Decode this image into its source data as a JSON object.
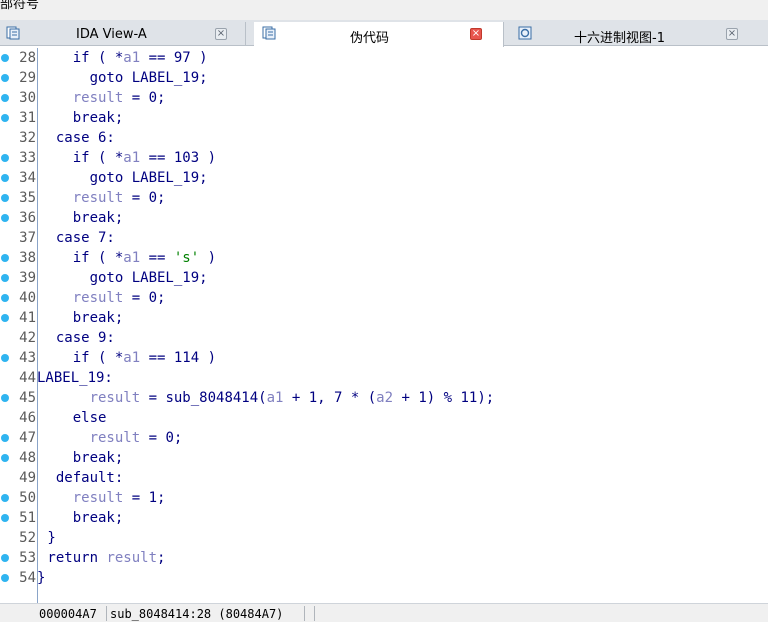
{
  "topbar": {
    "title": "部符号"
  },
  "tabs": [
    {
      "label": "IDA View-A",
      "icon": "ida-view-icon",
      "active": false
    },
    {
      "label": "伪代码",
      "icon": "pseudocode-icon",
      "active": true
    },
    {
      "label": "十六进制视图-1",
      "icon": "hex-view-icon",
      "active": false
    }
  ],
  "tab_close_glyph": "×",
  "colors": {
    "keyword": "#000080",
    "variable": "#8080c0",
    "breakpoint_dot": "#2fb4f0",
    "active_close": "#e8554e"
  },
  "code_lines": [
    {
      "num": "28",
      "dot": true,
      "segs": [
        [
          "    if ( *",
          ""
        ],
        [
          "a1",
          "v"
        ],
        [
          " == 97 )",
          ""
        ]
      ]
    },
    {
      "num": "29",
      "dot": true,
      "segs": [
        [
          "      goto LABEL_19;",
          ""
        ]
      ]
    },
    {
      "num": "30",
      "dot": true,
      "segs": [
        [
          "    ",
          ""
        ],
        [
          "result",
          "v"
        ],
        [
          " = 0;",
          ""
        ]
      ]
    },
    {
      "num": "31",
      "dot": true,
      "segs": [
        [
          "    break;",
          ""
        ]
      ]
    },
    {
      "num": "32",
      "dot": false,
      "segs": [
        [
          "  case 6:",
          ""
        ]
      ]
    },
    {
      "num": "33",
      "dot": true,
      "segs": [
        [
          "    if ( *",
          ""
        ],
        [
          "a1",
          "v"
        ],
        [
          " == 103 )",
          ""
        ]
      ]
    },
    {
      "num": "34",
      "dot": true,
      "segs": [
        [
          "      goto LABEL_19;",
          ""
        ]
      ]
    },
    {
      "num": "35",
      "dot": true,
      "segs": [
        [
          "    ",
          ""
        ],
        [
          "result",
          "v"
        ],
        [
          " = 0;",
          ""
        ]
      ]
    },
    {
      "num": "36",
      "dot": true,
      "segs": [
        [
          "    break;",
          ""
        ]
      ]
    },
    {
      "num": "37",
      "dot": false,
      "segs": [
        [
          "  case 7:",
          ""
        ]
      ]
    },
    {
      "num": "38",
      "dot": true,
      "segs": [
        [
          "    if ( *",
          ""
        ],
        [
          "a1",
          "v"
        ],
        [
          " == ",
          ""
        ],
        [
          "'s'",
          "s"
        ],
        [
          " )",
          ""
        ]
      ]
    },
    {
      "num": "39",
      "dot": true,
      "segs": [
        [
          "      goto LABEL_19;",
          ""
        ]
      ]
    },
    {
      "num": "40",
      "dot": true,
      "segs": [
        [
          "    ",
          ""
        ],
        [
          "result",
          "v"
        ],
        [
          " = 0;",
          ""
        ]
      ]
    },
    {
      "num": "41",
      "dot": true,
      "segs": [
        [
          "    break;",
          ""
        ]
      ]
    },
    {
      "num": "42",
      "dot": false,
      "segs": [
        [
          "  case 9:",
          ""
        ]
      ]
    },
    {
      "num": "43",
      "dot": true,
      "segs": [
        [
          "    if ( *",
          ""
        ],
        [
          "a1",
          "v"
        ],
        [
          " == 114 )",
          ""
        ]
      ]
    },
    {
      "num": "44",
      "dot": false,
      "segs": [
        [
          "LABEL_19:",
          ""
        ]
      ],
      "nogap": true
    },
    {
      "num": "45",
      "dot": true,
      "segs": [
        [
          "      ",
          ""
        ],
        [
          "result",
          "v"
        ],
        [
          " = sub_8048414(",
          ""
        ],
        [
          "a1",
          "v"
        ],
        [
          " + 1, 7 * (",
          ""
        ],
        [
          "a2",
          "v"
        ],
        [
          " + 1) % 11);",
          ""
        ]
      ]
    },
    {
      "num": "46",
      "dot": false,
      "segs": [
        [
          "    else",
          ""
        ]
      ]
    },
    {
      "num": "47",
      "dot": true,
      "segs": [
        [
          "      ",
          ""
        ],
        [
          "result",
          "v"
        ],
        [
          " = 0;",
          ""
        ]
      ]
    },
    {
      "num": "48",
      "dot": true,
      "segs": [
        [
          "    break;",
          ""
        ]
      ]
    },
    {
      "num": "49",
      "dot": false,
      "segs": [
        [
          "  default:",
          ""
        ]
      ]
    },
    {
      "num": "50",
      "dot": true,
      "segs": [
        [
          "    ",
          ""
        ],
        [
          "result",
          "v"
        ],
        [
          " = 1;",
          ""
        ]
      ]
    },
    {
      "num": "51",
      "dot": true,
      "segs": [
        [
          "    break;",
          ""
        ]
      ]
    },
    {
      "num": "52",
      "dot": false,
      "segs": [
        [
          " }",
          ""
        ]
      ]
    },
    {
      "num": "53",
      "dot": true,
      "segs": [
        [
          " return ",
          ""
        ],
        [
          "result",
          "v"
        ],
        [
          ";",
          ""
        ]
      ]
    },
    {
      "num": "54",
      "dot": true,
      "segs": [
        [
          "}",
          ""
        ]
      ],
      "nogap": true
    }
  ],
  "statusbar": {
    "address": "000004A7",
    "location": "sub_8048414:28 (80484A7)"
  }
}
